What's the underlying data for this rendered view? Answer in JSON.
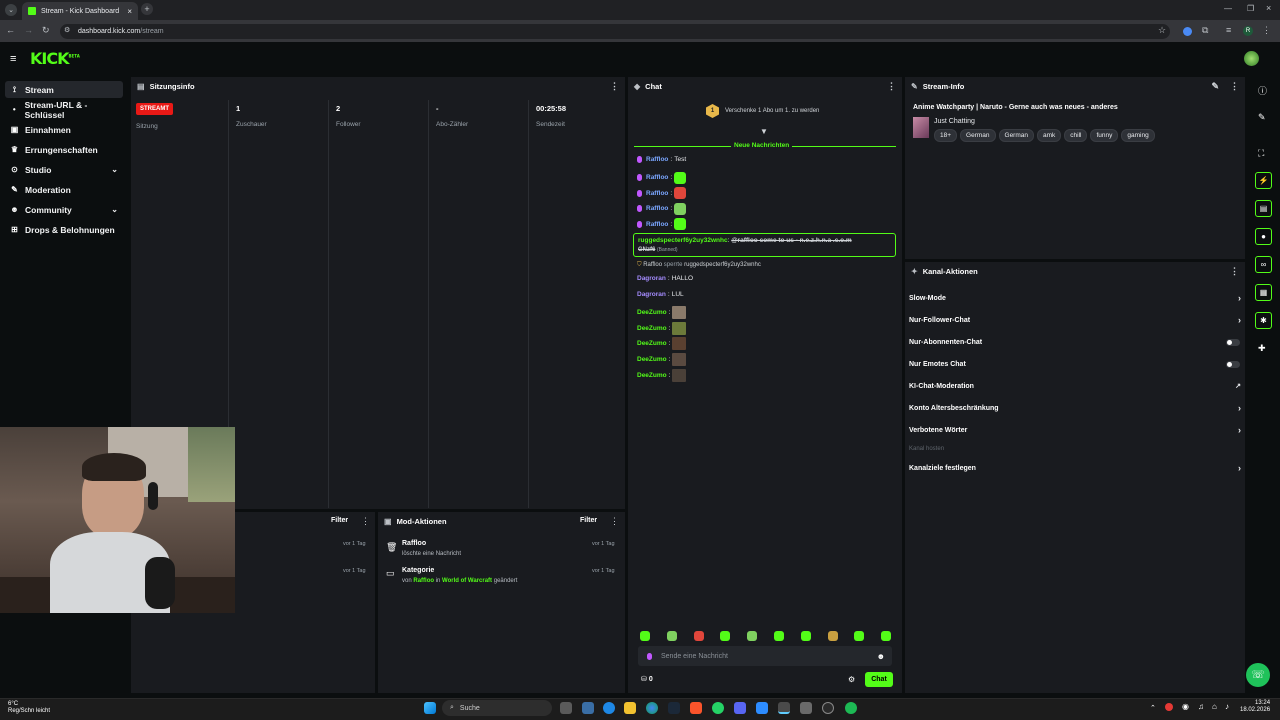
{
  "browser": {
    "tab_title": "Stream - Kick Dashboard",
    "url_host": "dashboard.kick.com",
    "url_path": "/stream"
  },
  "app": {
    "logo": "KICK",
    "logo_badge": "BETA"
  },
  "sidebar": {
    "items": [
      {
        "label": "Stream",
        "icon": "broadcast-icon",
        "active": true
      },
      {
        "label": "Stream-URL & -Schlüssel",
        "icon": "dot-icon"
      },
      {
        "label": "Einnahmen",
        "icon": "money-icon"
      },
      {
        "label": "Errungenschaften",
        "icon": "trophy-icon"
      },
      {
        "label": "Studio",
        "icon": "studio-icon",
        "chevron": true
      },
      {
        "label": "Moderation",
        "icon": "wrench-icon"
      },
      {
        "label": "Community",
        "icon": "community-icon",
        "chevron": true
      },
      {
        "label": "Drops & Belohnungen",
        "icon": "gift-icon"
      }
    ]
  },
  "session": {
    "title": "Sitzungsinfo",
    "live_badge": "STREAMT",
    "session_label": "Sitzung",
    "stats": [
      {
        "value": "1",
        "label": "Zuschauer"
      },
      {
        "value": "2",
        "label": "Follower"
      },
      {
        "value": "-",
        "label": "Abo-Zähler"
      },
      {
        "value": "00:25:58",
        "label": "Sendezeit"
      }
    ]
  },
  "activity": {
    "filter": "Filter",
    "rows": [
      {
        "time": "vor 1 Tag"
      },
      {
        "time": "vor 1 Tag"
      }
    ]
  },
  "mod_actions": {
    "title": "Mod-Aktionen",
    "filter": "Filter",
    "rows": [
      {
        "title": "Raffloo",
        "sub": "löschte eine Nachricht",
        "time": "vor 1 Tag"
      },
      {
        "title": "Kategorie",
        "sub_prefix": "von",
        "user": "Raffloo",
        "sub_mid": "in",
        "game": "World of Warcraft",
        "sub_suffix": "geändert",
        "time": "vor 1 Tag"
      }
    ]
  },
  "chat": {
    "title": "Chat",
    "gift_text": "Verschenke 1 Abo um 1. zu werden",
    "gift_count": "1",
    "new_messages": "Neue Nachrichten",
    "messages": [
      {
        "user": "Raffloo",
        "text": "Test"
      },
      {
        "user": "Raffloo",
        "emote": "#53fc18"
      },
      {
        "user": "Raffloo",
        "emote": "#e0463b"
      },
      {
        "user": "Raffloo",
        "emote": "#7fd160"
      },
      {
        "user": "Raffloo",
        "emote": "#53fc18"
      }
    ],
    "banned": {
      "user": "ruggedspecterf6y2uy32wnhc",
      "text": "@raffloo come to us - n.e.z.h.n.a .c.o.m",
      "text2": "GNzf6",
      "tag": "(Banned)"
    },
    "system": {
      "user": "Raffloo",
      "action": "sperrte",
      "target": "ruggedspecterf6y2uy32wnhc"
    },
    "messages2": [
      {
        "user": "Dagroran",
        "text": "HALLO"
      },
      {
        "user": "Dagroran",
        "text": "LUL"
      },
      {
        "user": "DeeZumo",
        "emote": "#8a7a6a"
      },
      {
        "user": "DeeZumo",
        "emote": "#6c7a3a"
      },
      {
        "user": "DeeZumo",
        "emote": "#5a4030"
      },
      {
        "user": "DeeZumo",
        "emote": "#5a4a40"
      },
      {
        "user": "DeeZumo",
        "emote": "#4a4038"
      }
    ],
    "input_placeholder": "Sende eine Nachricht",
    "send_label": "Chat",
    "points": "0",
    "emote_bar": [
      "#53fc18",
      "#7fd160",
      "#e0463b",
      "#53fc18",
      "#7fd160",
      "#53fc18",
      "#53fc18",
      "#c9a040",
      "#53fc18",
      "#53fc18"
    ]
  },
  "stream_info": {
    "title": "Stream-Info",
    "stream_title": "Anime Watchparty | Naruto - Gerne auch was neues - anderes",
    "category": "Just Chatting",
    "tags": [
      "18+",
      "German",
      "German",
      "amk",
      "chill",
      "funny",
      "gaming"
    ]
  },
  "kanal": {
    "title": "Kanal-Aktionen",
    "rows": [
      {
        "label": "Slow-Mode",
        "control": "chevron"
      },
      {
        "label": "Nur-Follower-Chat",
        "control": "chevron"
      },
      {
        "label": "Nur-Abonnenten-Chat",
        "control": "toggle"
      },
      {
        "label": "Nur Emotes Chat",
        "control": "toggle"
      },
      {
        "label": "KI-Chat-Moderation",
        "control": "external"
      },
      {
        "label": "Konto Altersbeschränkung",
        "control": "chevron"
      },
      {
        "label": "Verbotene Wörter",
        "control": "chevron"
      },
      {
        "label": "Kanal hosten",
        "control": "none",
        "disabled": true
      },
      {
        "label": "Kanalziele festlegen",
        "control": "chevron"
      }
    ]
  },
  "taskbar": {
    "weather_temp": "6°C",
    "weather_text": "Reg/Schn leicht",
    "search": "Suche",
    "time": "13:24",
    "date": "18.02.2026"
  },
  "colors": {
    "accent": "#53fc18",
    "live": "#e91916",
    "panel": "#191b1f"
  }
}
